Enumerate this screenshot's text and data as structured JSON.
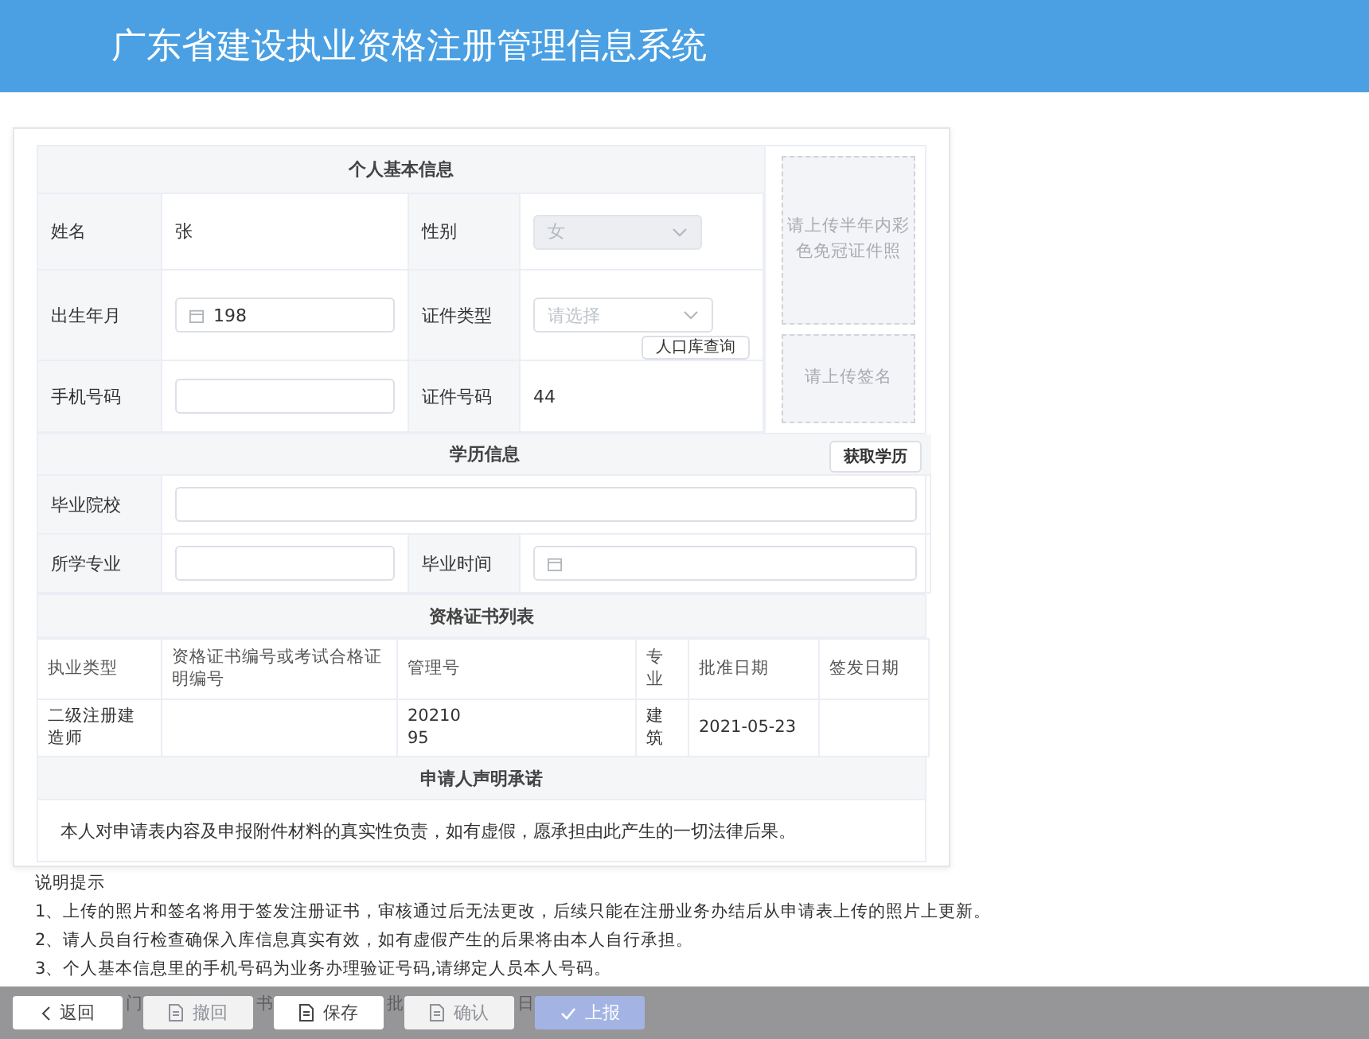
{
  "header": {
    "title": "广东省建设执业资格注册管理信息系统"
  },
  "personal": {
    "title": "个人基本信息",
    "fields": [
      {
        "label": "姓名",
        "kind": "text",
        "value": "张"
      },
      {
        "label": "性别",
        "kind": "select",
        "value": "女",
        "disabled": true
      },
      {
        "label": "出生年月",
        "kind": "date",
        "value": "198"
      },
      {
        "label": "证件类型",
        "kind": "select",
        "placeholder": "请选择",
        "disabled": false,
        "button": "人口库查询"
      },
      {
        "label": "手机号码",
        "kind": "input"
      },
      {
        "label": "证件号码",
        "kind": "text",
        "value": "44"
      }
    ],
    "photo_upload": "请上传半年内彩色免冠证件照",
    "signature_upload": "请上传签名"
  },
  "education": {
    "title": "学历信息",
    "button": "获取学历",
    "fields": [
      {
        "label": "毕业院校",
        "kind": "input",
        "wide": true
      },
      {
        "label": "所学专业",
        "kind": "input",
        "wide": false
      },
      {
        "label": "毕业时间",
        "kind": "date",
        "wide": false
      }
    ]
  },
  "certificates": {
    "title": "资格证书列表",
    "columns": [
      "执业类型",
      "资格证书编号或考试合格证明编号",
      "管理号",
      "专业",
      "批准日期",
      "签发日期"
    ],
    "rows": [
      [
        "二级注册建造师",
        "",
        "20210\n95",
        "建筑",
        "2021-05-23",
        ""
      ]
    ]
  },
  "declaration": {
    "title": "申请人声明承诺",
    "text": "本人对申请表内容及申报附件材料的真实性负责，如有虚假，愿承担由此产生的一切法律后果。"
  },
  "notes": {
    "title": "说明提示",
    "items": [
      "1、上传的照片和签名将用于签发注册证书，审核通过后无法更改，后续只能在注册业务办结后从申请表上传的照片上更新。",
      "2、请人员自行检查确保入库信息真实有效，如有虚假产生的后果将由本人自行承担。",
      "3、个人基本信息里的手机号码为业务办理验证号码,请绑定人员本人号码。"
    ],
    "fragments": [
      "门",
      "书",
      "批",
      "日"
    ]
  },
  "footer": {
    "buttons": [
      {
        "label": "返回",
        "kind": "back",
        "disabled": false
      },
      {
        "label": "撤回",
        "kind": "document",
        "disabled": true
      },
      {
        "label": "保存",
        "kind": "document",
        "disabled": false
      },
      {
        "label": "确认",
        "kind": "document",
        "disabled": true
      },
      {
        "label": "上报",
        "kind": "submit",
        "disabled": true
      }
    ]
  }
}
